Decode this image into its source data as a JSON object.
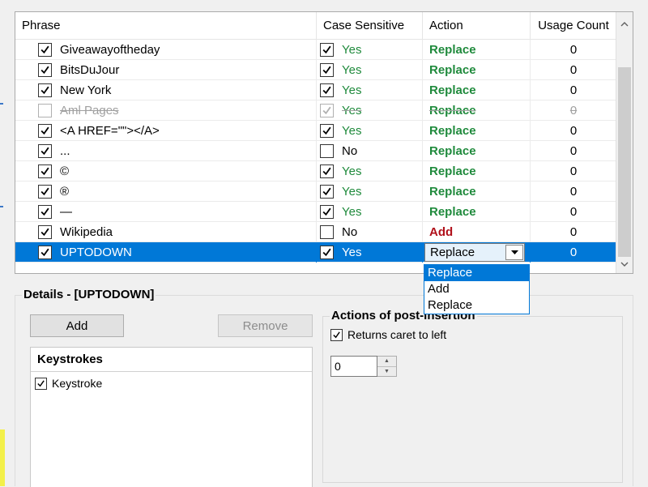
{
  "grid": {
    "headers": {
      "phrase": "Phrase",
      "case_sensitive": "Case Sensitive",
      "action": "Action",
      "usage_count": "Usage Count"
    },
    "rows": [
      {
        "phrase": "Giveawayoftheday",
        "enabled": true,
        "case": "Yes",
        "action": "Replace",
        "count": "0"
      },
      {
        "phrase": "BitsDuJour",
        "enabled": true,
        "case": "Yes",
        "action": "Replace",
        "count": "0"
      },
      {
        "phrase": "New York",
        "enabled": true,
        "case": "Yes",
        "action": "Replace",
        "count": "0"
      },
      {
        "phrase": "Aml Pages",
        "enabled": false,
        "case": "Yes",
        "action": "Replace",
        "count": "0"
      },
      {
        "phrase": "<A HREF=\"\"></A>",
        "enabled": true,
        "case": "Yes",
        "action": "Replace",
        "count": "0"
      },
      {
        "phrase": "...",
        "enabled": true,
        "case": "No",
        "action": "Replace",
        "count": "0"
      },
      {
        "phrase": "©",
        "enabled": true,
        "case": "Yes",
        "action": "Replace",
        "count": "0"
      },
      {
        "phrase": "®",
        "enabled": true,
        "case": "Yes",
        "action": "Replace",
        "count": "0"
      },
      {
        "phrase": "—",
        "enabled": true,
        "case": "Yes",
        "action": "Replace",
        "count": "0"
      },
      {
        "phrase": "Wikipedia",
        "enabled": true,
        "case": "No",
        "action": "Add",
        "count": "0"
      },
      {
        "phrase": "UPTODOWN",
        "enabled": true,
        "case": "Yes",
        "action": "Replace",
        "count": "0",
        "selected": true
      }
    ]
  },
  "action_dropdown": {
    "options": [
      "Replace",
      "Add",
      "Replace"
    ],
    "highlighted_index": 0
  },
  "details": {
    "title": "Details - [UPTODOWN]",
    "add_label": "Add",
    "remove_label": "Remove",
    "keystrokes_header": "Keystrokes",
    "keystroke_item": "Keystroke",
    "post_insertion_title": "Actions of post-insertion",
    "returns_caret_label": "Returns caret to left",
    "spin_value": "0"
  },
  "colors": {
    "yes_green": "#1f8a3c",
    "add_red": "#b0101a",
    "selection_blue": "#0078d7"
  }
}
